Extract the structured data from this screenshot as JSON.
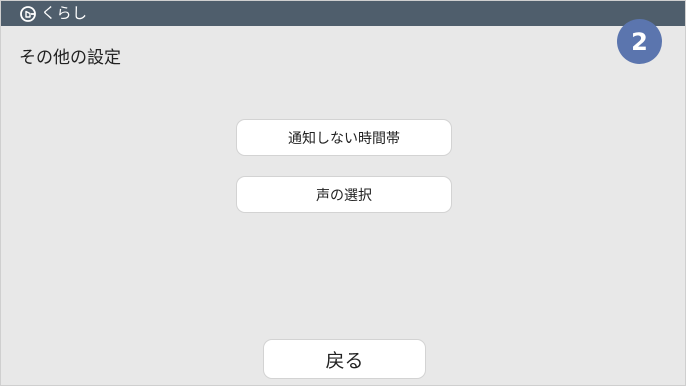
{
  "app": {
    "name": "くらし",
    "icon": "at-home-icon"
  },
  "page": {
    "title": "その他の設定",
    "step_number": "2"
  },
  "menu": {
    "items": [
      {
        "label": "通知しない時間帯"
      },
      {
        "label": "声の選択"
      }
    ]
  },
  "footer": {
    "back_label": "戻る"
  },
  "colors": {
    "topbar": "#4f5e6c",
    "background": "#e8e8e8",
    "badge": "#5b75ae",
    "button": "#ffffff"
  }
}
